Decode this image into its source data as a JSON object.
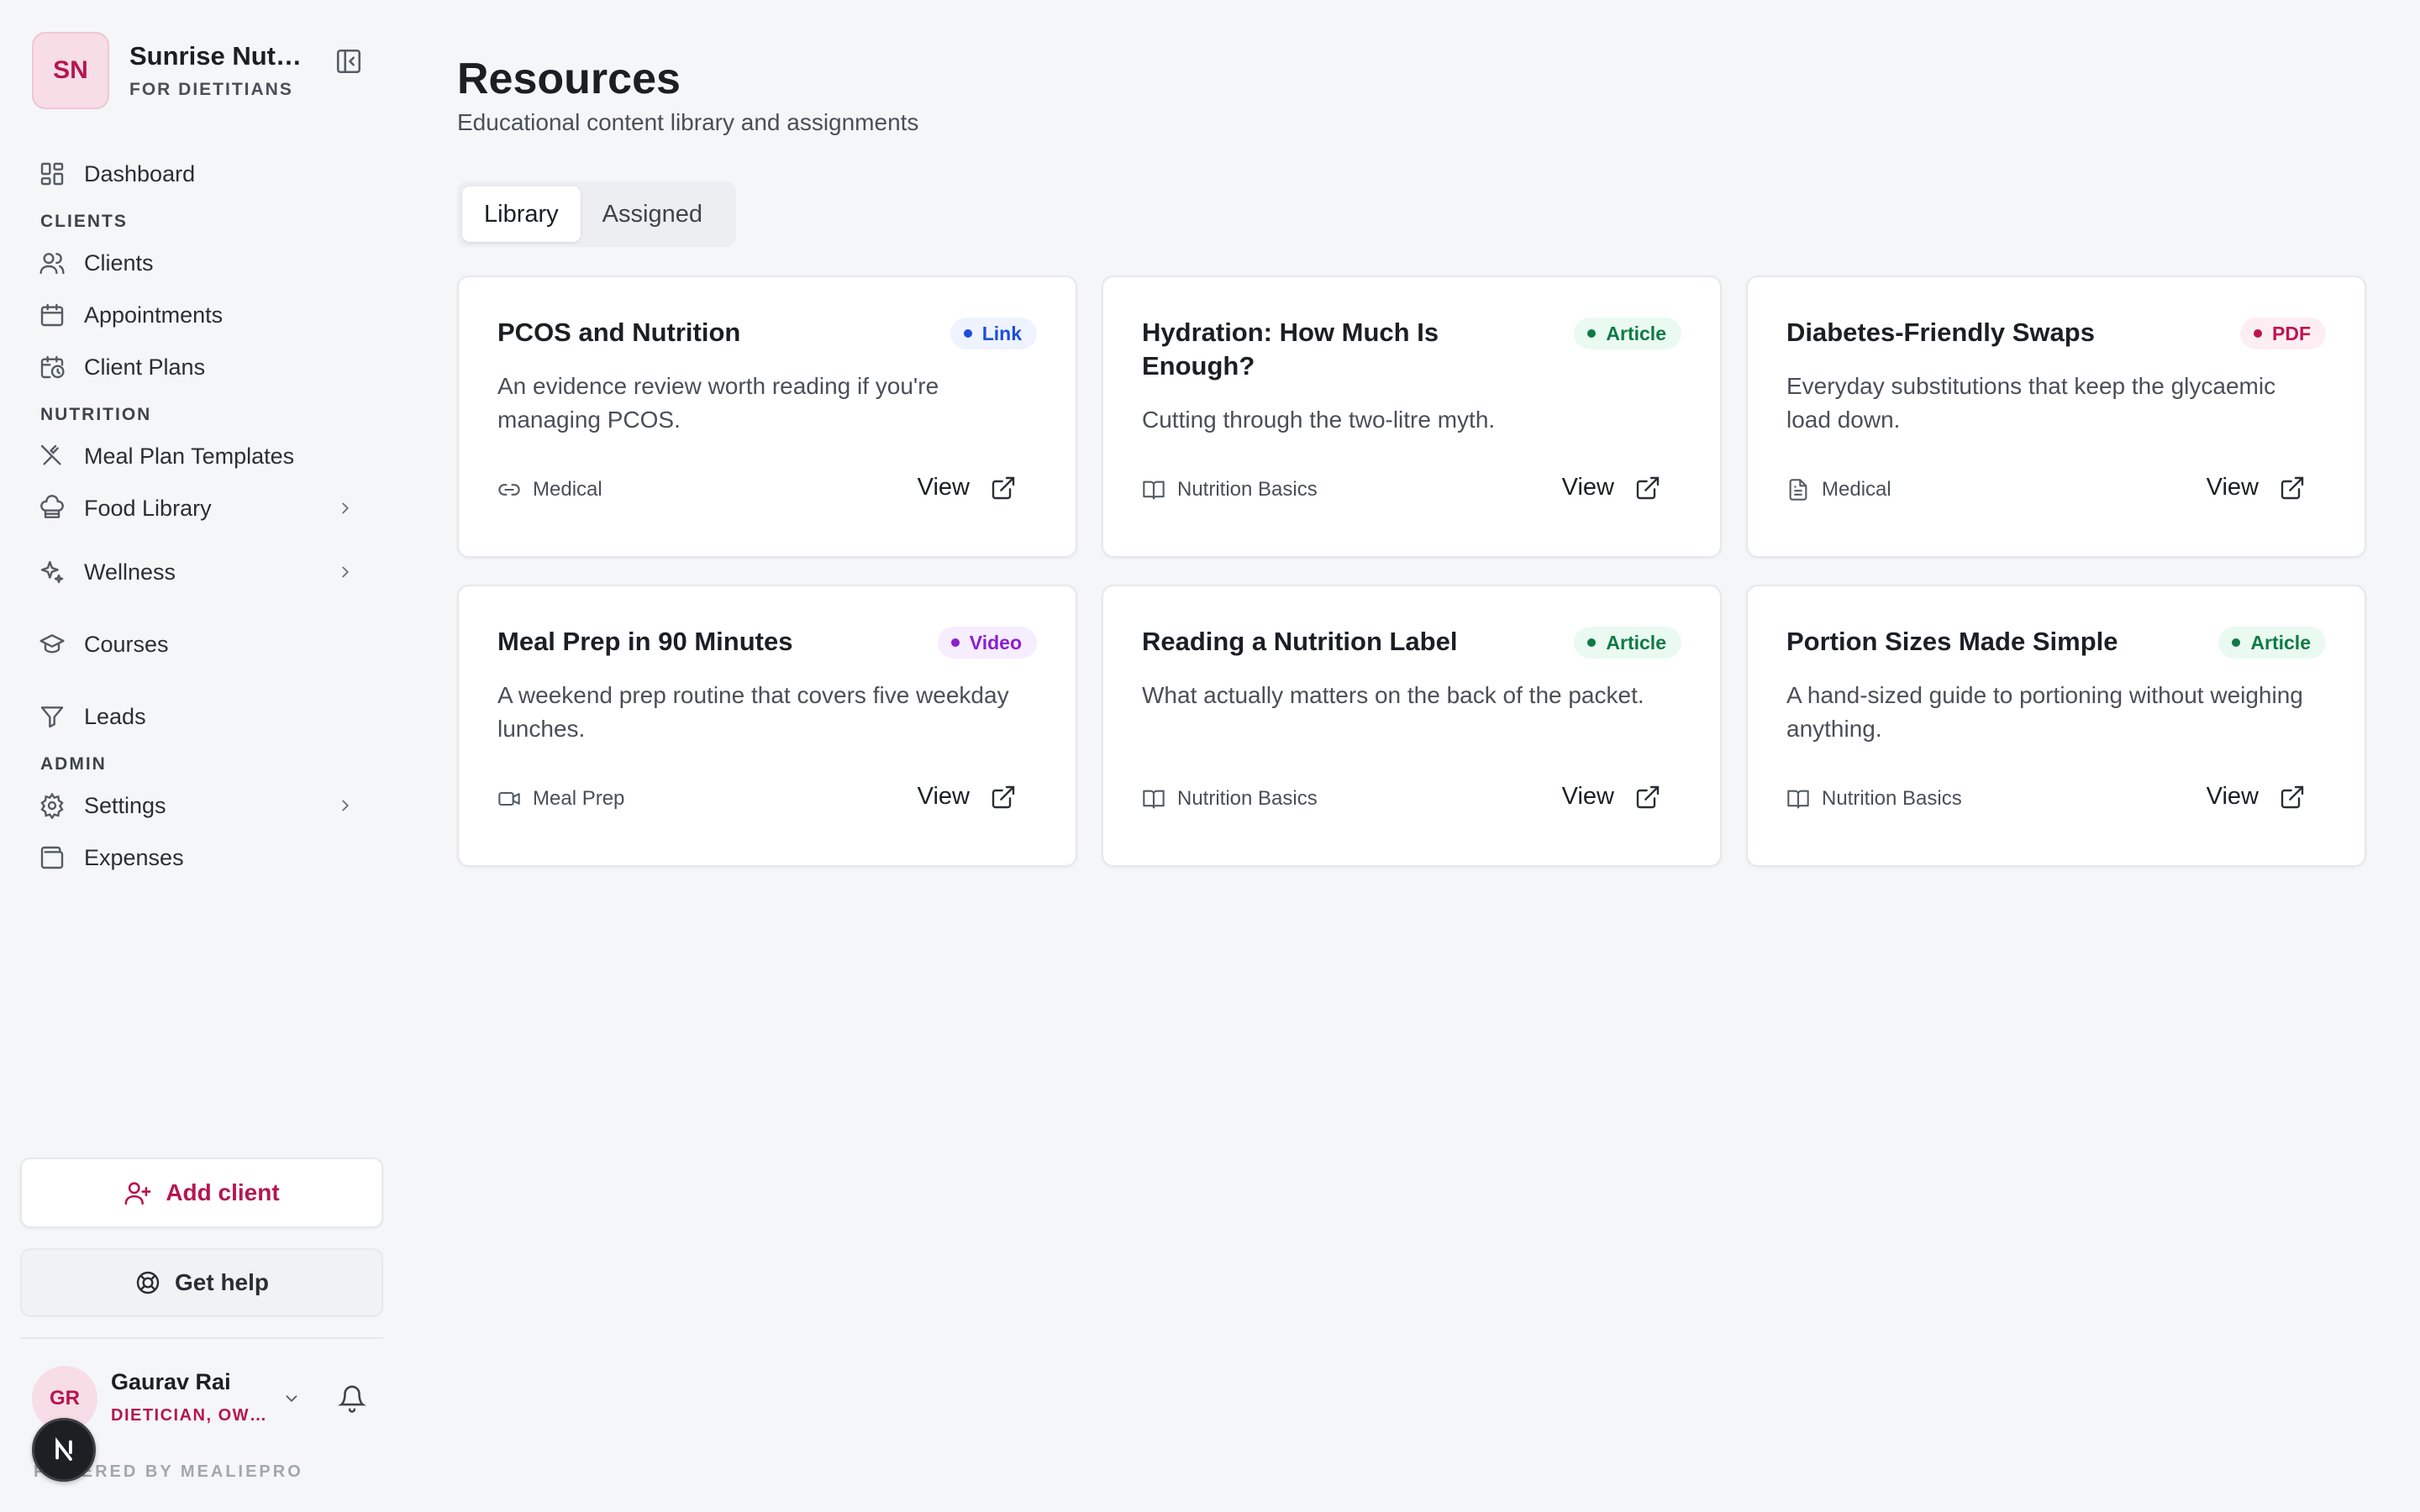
{
  "brand": {
    "initials": "SN",
    "name": "Sunrise Nutrition",
    "subtitle": "FOR DIETITIANS"
  },
  "nav": {
    "dashboard": "Dashboard",
    "section_clients": "CLIENTS",
    "clients": "Clients",
    "appointments": "Appointments",
    "client_plans": "Client Plans",
    "section_nutrition": "NUTRITION",
    "meal_plan_templates": "Meal Plan Templates",
    "food_library": "Food Library",
    "wellness": "Wellness",
    "courses": "Courses",
    "leads": "Leads",
    "section_admin": "ADMIN",
    "settings": "Settings",
    "expenses": "Expenses"
  },
  "actions": {
    "add_client": "Add client",
    "get_help": "Get help"
  },
  "user": {
    "initials": "GR",
    "name": "Gaurav Rai",
    "role": "DIETICIAN, OWNER"
  },
  "footer": {
    "powered_by": "POWERED BY MEALIEPRO"
  },
  "page": {
    "title": "Resources",
    "subtitle": "Educational content library and assignments"
  },
  "tabs": [
    {
      "label": "Library",
      "active": true
    },
    {
      "label": "Assigned",
      "active": false
    }
  ],
  "resources": [
    {
      "title": "PCOS and Nutrition",
      "type": "Link",
      "description": "An evidence review worth reading if you're managing PCOS.",
      "category": "Medical",
      "category_icon": "link-icon",
      "view_label": "View"
    },
    {
      "title": "Hydration: How Much Is Enough?",
      "type": "Article",
      "description": "Cutting through the two-litre myth.",
      "category": "Nutrition Basics",
      "category_icon": "book-icon",
      "view_label": "View"
    },
    {
      "title": "Diabetes-Friendly Swaps",
      "type": "PDF",
      "description": "Everyday substitutions that keep the glycaemic load down.",
      "category": "Medical",
      "category_icon": "file-icon",
      "view_label": "View"
    },
    {
      "title": "Meal Prep in 90 Minutes",
      "type": "Video",
      "description": "A weekend prep routine that covers five weekday lunches.",
      "category": "Meal Prep",
      "category_icon": "video-icon",
      "view_label": "View"
    },
    {
      "title": "Reading a Nutrition Label",
      "type": "Article",
      "description": "What actually matters on the back of the packet.",
      "category": "Nutrition Basics",
      "category_icon": "book-icon",
      "view_label": "View"
    },
    {
      "title": "Portion Sizes Made Simple",
      "type": "Article",
      "description": "A hand-sized guide to portioning without weighing anything.",
      "category": "Nutrition Basics",
      "category_icon": "book-icon",
      "view_label": "View"
    }
  ],
  "badge_colors": {
    "Link": {
      "bg": "#eef3ff",
      "fg": "#1d4ed8"
    },
    "Article": {
      "bg": "#eafaf1",
      "fg": "#0f7a45"
    },
    "PDF": {
      "bg": "#fdeef3",
      "fg": "#be1550"
    },
    "Video": {
      "bg": "#f6edfe",
      "fg": "#8b1fd0"
    }
  },
  "colors": {
    "accent": "#b5164f",
    "background": "#f5f6f8"
  }
}
